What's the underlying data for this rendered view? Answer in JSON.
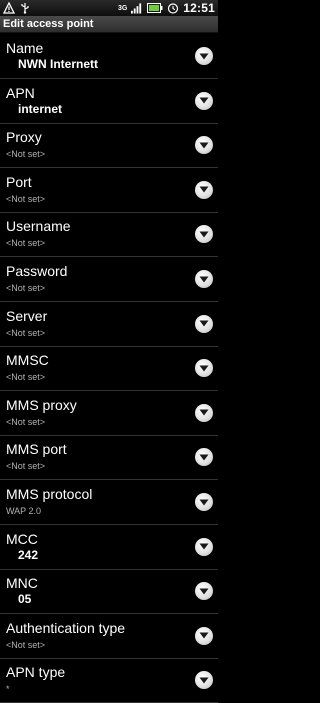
{
  "status_bar": {
    "time": "12:51",
    "network": "3G",
    "icons": [
      "warning-icon",
      "usb-icon",
      "network-3g-icon",
      "signal-icon",
      "battery-icon",
      "alarm-icon"
    ]
  },
  "title": "Edit access point",
  "rows": [
    {
      "label": "Name",
      "value": "NWN Internett"
    },
    {
      "label": "APN",
      "value": "internet"
    },
    {
      "label": "Proxy",
      "value": "<Not set>"
    },
    {
      "label": "Port",
      "value": "<Not set>"
    },
    {
      "label": "Username",
      "value": "<Not set>"
    },
    {
      "label": "Password",
      "value": "<Not set>"
    },
    {
      "label": "Server",
      "value": "<Not set>"
    },
    {
      "label": "MMSC",
      "value": "<Not set>"
    },
    {
      "label": "MMS proxy",
      "value": "<Not set>"
    },
    {
      "label": "MMS port",
      "value": "<Not set>"
    },
    {
      "label": "MMS protocol",
      "value": "WAP 2.0"
    },
    {
      "label": "MCC",
      "value": "242"
    },
    {
      "label": "MNC",
      "value": "05"
    },
    {
      "label": "Authentication type",
      "value": "<Not set>"
    },
    {
      "label": "APN type",
      "value": "*"
    }
  ]
}
